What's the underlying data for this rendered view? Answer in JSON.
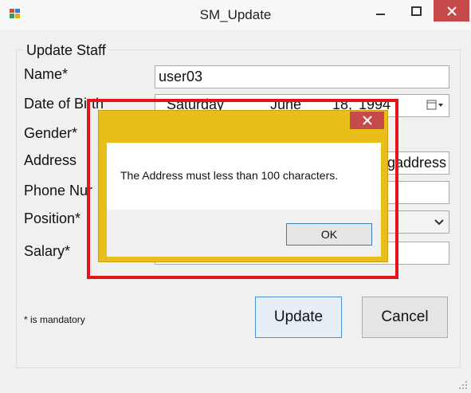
{
  "window": {
    "title": "SM_Update"
  },
  "form": {
    "group_title": "Update Staff",
    "labels": {
      "name": "Name*",
      "dob": "Date of Birth",
      "gender": "Gender*",
      "address": "Address",
      "phone": "Phone Nur",
      "position": "Position*",
      "salary": "Salary*"
    },
    "name_value": "user03",
    "dob": {
      "day": "Saturday",
      "comma": ",",
      "month": "June",
      "date": "18,",
      "year": "1994"
    },
    "address_value": "gaddress",
    "mandatory_note": "* is mandatory",
    "update_label": "Update",
    "cancel_label": "Cancel"
  },
  "dialog": {
    "message": "The Address must less than 100 characters.",
    "ok_label": "OK"
  },
  "colors": {
    "dialog_frame": "#e8be1a",
    "highlight": "#e2151b",
    "close_button": "#c74a4a"
  }
}
